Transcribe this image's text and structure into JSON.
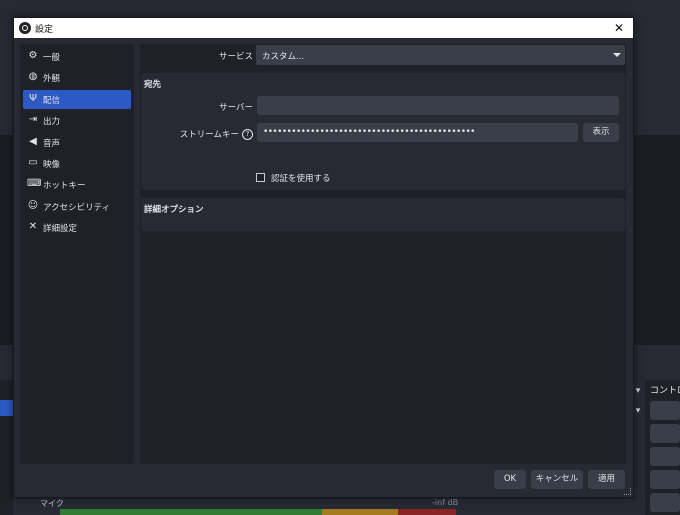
{
  "dialog": {
    "title": "設定",
    "close_glyph": "✕"
  },
  "sidebar": {
    "items": [
      {
        "label": "一般",
        "icon": "gear-icon",
        "glyph": "⚙"
      },
      {
        "label": "外観",
        "icon": "appearance-icon",
        "glyph": "◍"
      },
      {
        "label": "配信",
        "icon": "antenna-icon",
        "glyph": "Ψ"
      },
      {
        "label": "出力",
        "icon": "output-icon",
        "glyph": "⇥"
      },
      {
        "label": "音声",
        "icon": "speaker-icon",
        "glyph": "◀"
      },
      {
        "label": "映像",
        "icon": "monitor-icon",
        "glyph": "▭"
      },
      {
        "label": "ホットキー",
        "icon": "keyboard-icon",
        "glyph": "⌨"
      },
      {
        "label": "アクセシビリティ",
        "icon": "accessibility-icon",
        "glyph": "☺"
      },
      {
        "label": "詳細設定",
        "icon": "tools-icon",
        "glyph": "✕"
      }
    ],
    "active_index": 2,
    "active_color": "#2c59c4"
  },
  "stream": {
    "service_label": "サービス",
    "service_value": "カスタム...",
    "destination_title": "宛先",
    "server_label": "サーバー",
    "server_value": "",
    "key_label": "ストリームキー",
    "key_help": "?",
    "key_value": "•••••••••••••••••••••••••••••••••••••••••••••",
    "show_button": "表示",
    "auth_checkbox_label": "認証を使用する",
    "auth_checked": false,
    "advanced_title": "詳細オプション"
  },
  "footer": {
    "ok": "OK",
    "cancel": "キャンセル",
    "apply": "適用"
  },
  "background": {
    "controls_title": "コントロー",
    "mic_label": "マイク",
    "mic_db": "-inf dB"
  }
}
